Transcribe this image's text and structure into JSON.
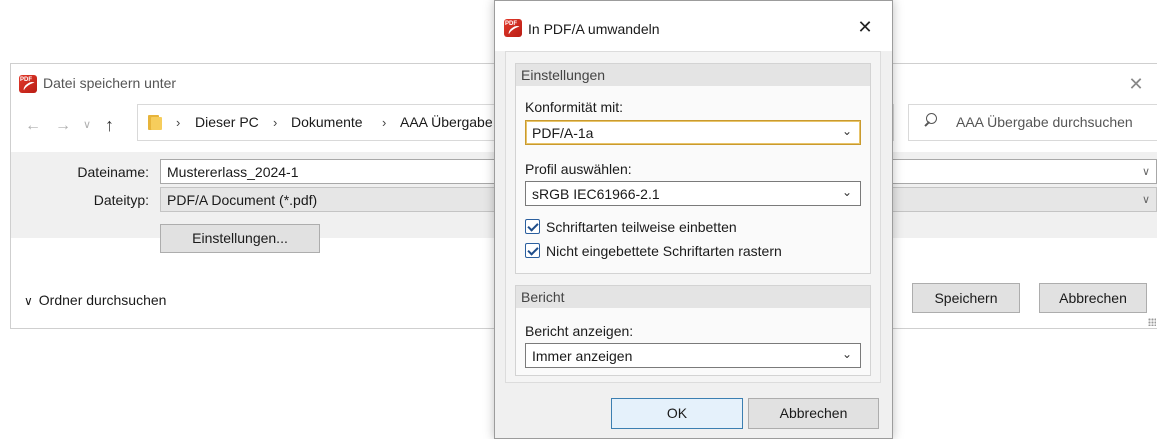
{
  "save_dialog": {
    "title": "Datei speichern unter",
    "close_glyph": "✕",
    "nav": {
      "back_glyph": "←",
      "forward_glyph": "→",
      "recent_glyph": "∨",
      "up_glyph": "↑"
    },
    "breadcrumb": [
      "Dieser PC",
      "Dokumente",
      "AAA Übergabe"
    ],
    "breadcrumb_separator": "›",
    "search_placeholder": "AAA Übergabe durchsuchen",
    "filename_label": "Dateiname:",
    "filename_value": "Mustererlass_2024-1",
    "filetype_label": "Dateityp:",
    "filetype_value": "PDF/A Document (*.pdf)",
    "settings_button": "Einstellungen...",
    "browse_folders": "Ordner durchsuchen",
    "browse_chevron": "∨",
    "save_button": "Speichern",
    "cancel_button": "Abbrechen"
  },
  "pdfa_dialog": {
    "title": "In PDF/A umwandeln",
    "close_glyph": "✕",
    "settings_group": {
      "header": "Einstellungen",
      "conformity_label": "Konformität mit:",
      "conformity_value": "PDF/A-1a",
      "profile_label": "Profil auswählen:",
      "profile_value": "sRGB IEC61966-2.1",
      "checkboxes": [
        {
          "label": "Schriftarten teilweise einbetten",
          "checked": true
        },
        {
          "label": "Nicht eingebettete Schriftarten rastern",
          "checked": true
        }
      ]
    },
    "report_group": {
      "header": "Bericht",
      "show_label": "Bericht anzeigen:",
      "show_value": "Immer anzeigen"
    },
    "ok_button": "OK",
    "cancel_button": "Abbrechen"
  },
  "icons": {
    "app": "pdf-app-icon",
    "folder": "folder-icon",
    "search": "search-icon"
  },
  "colors": {
    "app_red": "#d52b1e",
    "focus_border": "#c99a2e",
    "default_button_border": "#3c7fb1",
    "checkbox_blue": "#1f4d8a"
  }
}
